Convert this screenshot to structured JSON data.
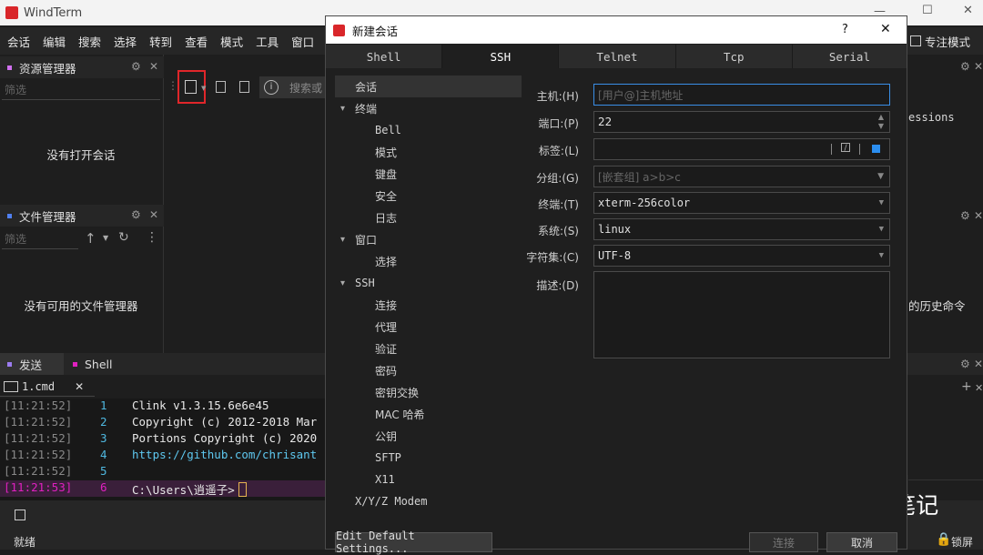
{
  "app": {
    "title": "WindTerm"
  },
  "window_controls": [
    "—",
    "☐",
    "✕"
  ],
  "menu": [
    "会话",
    "编辑",
    "搜索",
    "选择",
    "转到",
    "查看",
    "模式",
    "工具",
    "窗口",
    "帮"
  ],
  "right_menu": {
    "label": "专注模式"
  },
  "resource_manager": {
    "title": "资源管理器",
    "filter_placeholder": "筛选",
    "empty": "没有打开会话"
  },
  "file_manager": {
    "title": "文件管理器",
    "filter_placeholder": "筛选",
    "empty": "没有可用的文件管理器"
  },
  "toolbar": {
    "search_placeholder": "搜索或"
  },
  "right_panel": {
    "sessions_text": "essions",
    "history_text": "的历史命令"
  },
  "bottom_tabs": {
    "send": "发送",
    "shell": "Shell"
  },
  "terminal": {
    "tab_label": "1.cmd",
    "lines": [
      {
        "time": "[11:21:52]",
        "num": "1",
        "text": "Clink v1.3.15.6e6e45"
      },
      {
        "time": "[11:21:52]",
        "num": "2",
        "text": "Copyright (c) 2012-2018 Mar"
      },
      {
        "time": "[11:21:52]",
        "num": "3",
        "text": "Portions Copyright (c) 2020"
      },
      {
        "time": "[11:21:52]",
        "num": "4",
        "text": "https://github.com/chrisant"
      },
      {
        "time": "[11:21:52]",
        "num": "5",
        "text": ""
      },
      {
        "time": "[11:21:53]",
        "num": "6",
        "text": "C:\\Users\\逍遥子>"
      }
    ]
  },
  "status": {
    "left": "就绪",
    "lock": "锁屏"
  },
  "watermark": "kali黑客笔记",
  "dialog": {
    "title": "新建会话",
    "help": "?",
    "close": "✕",
    "tabs": [
      "Shell",
      "SSH",
      "Telnet",
      "Tcp",
      "Serial"
    ],
    "active_tab": "SSH",
    "tree": [
      {
        "label": "会话",
        "level": 0,
        "arrow": ""
      },
      {
        "label": "终端",
        "level": 0,
        "arrow": "▾"
      },
      {
        "label": "Bell",
        "level": 1,
        "arrow": ""
      },
      {
        "label": "模式",
        "level": 1,
        "arrow": ""
      },
      {
        "label": "键盘",
        "level": 1,
        "arrow": ""
      },
      {
        "label": "安全",
        "level": 1,
        "arrow": ""
      },
      {
        "label": "日志",
        "level": 1,
        "arrow": ""
      },
      {
        "label": "窗口",
        "level": 0,
        "arrow": "▾"
      },
      {
        "label": "选择",
        "level": 1,
        "arrow": ""
      },
      {
        "label": "SSH",
        "level": 0,
        "arrow": "▾"
      },
      {
        "label": "连接",
        "level": 1,
        "arrow": ""
      },
      {
        "label": "代理",
        "level": 1,
        "arrow": ""
      },
      {
        "label": "验证",
        "level": 1,
        "arrow": ""
      },
      {
        "label": "密码",
        "level": 1,
        "arrow": ""
      },
      {
        "label": "密钥交换",
        "level": 1,
        "arrow": ""
      },
      {
        "label": "MAC 哈希",
        "level": 1,
        "arrow": ""
      },
      {
        "label": "公钥",
        "level": 1,
        "arrow": ""
      },
      {
        "label": "SFTP",
        "level": 1,
        "arrow": ""
      },
      {
        "label": "X11",
        "level": 1,
        "arrow": ""
      },
      {
        "label": "X/Y/Z Modem",
        "level": 0,
        "arrow": ""
      }
    ],
    "fields": {
      "host_label": "主机:(H)",
      "host_placeholder": "[用户@]主机地址",
      "port_label": "端口:(P)",
      "port_value": "22",
      "tag_label": "标签:(L)",
      "group_label": "分组:(G)",
      "group_placeholder": "[嵌套组] a>b>c",
      "terminal_label": "终端:(T)",
      "terminal_value": "xterm-256color",
      "system_label": "系统:(S)",
      "system_value": "linux",
      "charset_label": "字符集:(C)",
      "charset_value": "UTF-8",
      "desc_label": "描述:(D)"
    },
    "buttons": {
      "edit_default": "Edit Default Settings...",
      "connect": "连接",
      "cancel": "取消"
    }
  },
  "colors": {
    "accent_red": "#e0262a",
    "time_magenta": "#e020c0",
    "line_num_cyan": "#4fb8e0",
    "url_cyan": "#5ec8f0"
  }
}
